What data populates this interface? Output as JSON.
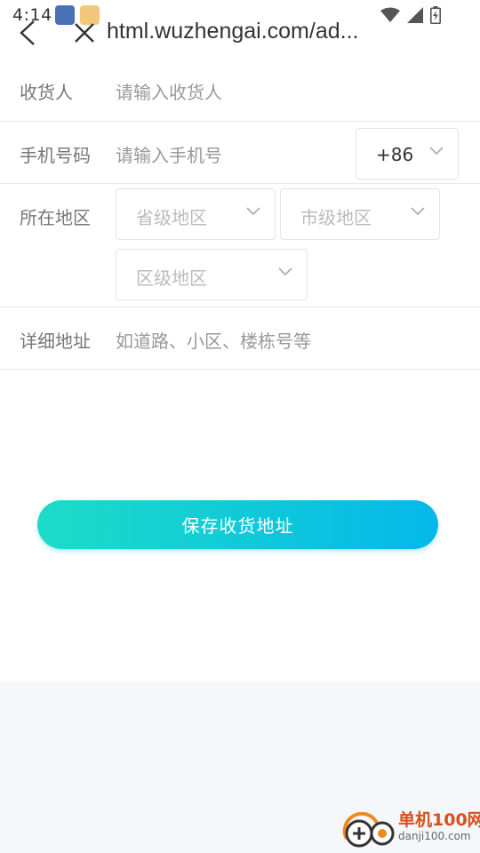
{
  "status_bar": {
    "time": "4:14"
  },
  "nav": {
    "url": "html.wuzhengai.com/ad..."
  },
  "form": {
    "consignee": {
      "label": "收货人",
      "placeholder": "请输入收货人"
    },
    "phone": {
      "label": "手机号码",
      "placeholder": "请输入手机号",
      "country_code": "+86"
    },
    "region": {
      "label": "所在地区",
      "province": "省级地区",
      "city": "市级地区",
      "district": "区级地区"
    },
    "address": {
      "label": "详细地址",
      "placeholder": "如道路、小区、楼栋号等"
    }
  },
  "save_button": {
    "label": "保存收货地址"
  },
  "watermark": {
    "title": "单机100网",
    "domain": "danji100.com"
  },
  "colors": {
    "button_start": "#1ddcc7",
    "button_end": "#05b8ea",
    "watermark": "#d9501a"
  }
}
